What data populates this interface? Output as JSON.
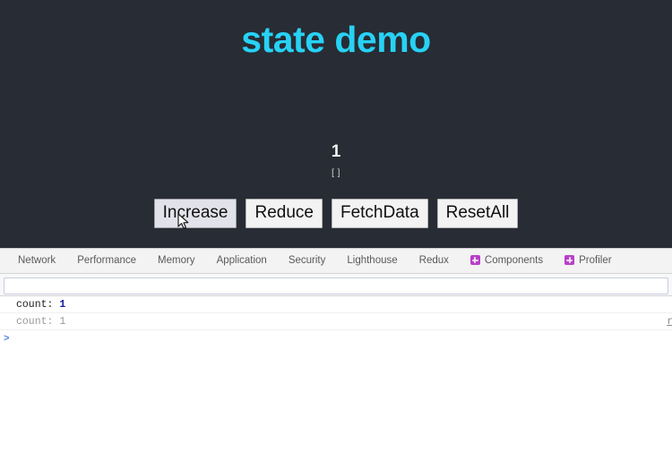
{
  "app": {
    "title": "state demo",
    "counter_value": "1",
    "counter_list": "[ ]",
    "buttons": [
      {
        "label": "Increase",
        "state": "hovered"
      },
      {
        "label": "Reduce",
        "state": "normal"
      },
      {
        "label": "FetchData",
        "state": "normal"
      },
      {
        "label": "ResetAll",
        "state": "normal"
      }
    ],
    "colors": {
      "background": "#282c34",
      "title": "#27d2f5",
      "counter": "#f2f2f2",
      "button_face": "#f3f3f3",
      "button_hover": "#e2e2ea"
    }
  },
  "devtools": {
    "tabs": [
      {
        "label": "Network",
        "icon": null
      },
      {
        "label": "Performance",
        "icon": null
      },
      {
        "label": "Memory",
        "icon": null
      },
      {
        "label": "Application",
        "icon": null
      },
      {
        "label": "Security",
        "icon": null
      },
      {
        "label": "Lighthouse",
        "icon": null
      },
      {
        "label": "Redux",
        "icon": null
      },
      {
        "label": "Components",
        "icon": "react-components-icon"
      },
      {
        "label": "Profiler",
        "icon": "react-profiler-icon"
      }
    ],
    "filter": {
      "value": "",
      "placeholder": ""
    },
    "console": {
      "rows": [
        {
          "key": "count:",
          "value": "1",
          "faded": false,
          "source": ""
        },
        {
          "key": "count:",
          "value": "1",
          "faded": true,
          "source": "re"
        }
      ],
      "prompt": ">"
    },
    "colors": {
      "tabbar_background": "#f3f3f3",
      "tab_text": "#5a5a5a",
      "react_icon": "#b93fc8",
      "console_value": "#1a1aa6",
      "console_faded": "#9a9a9a",
      "prompt": "#5482e8"
    }
  }
}
